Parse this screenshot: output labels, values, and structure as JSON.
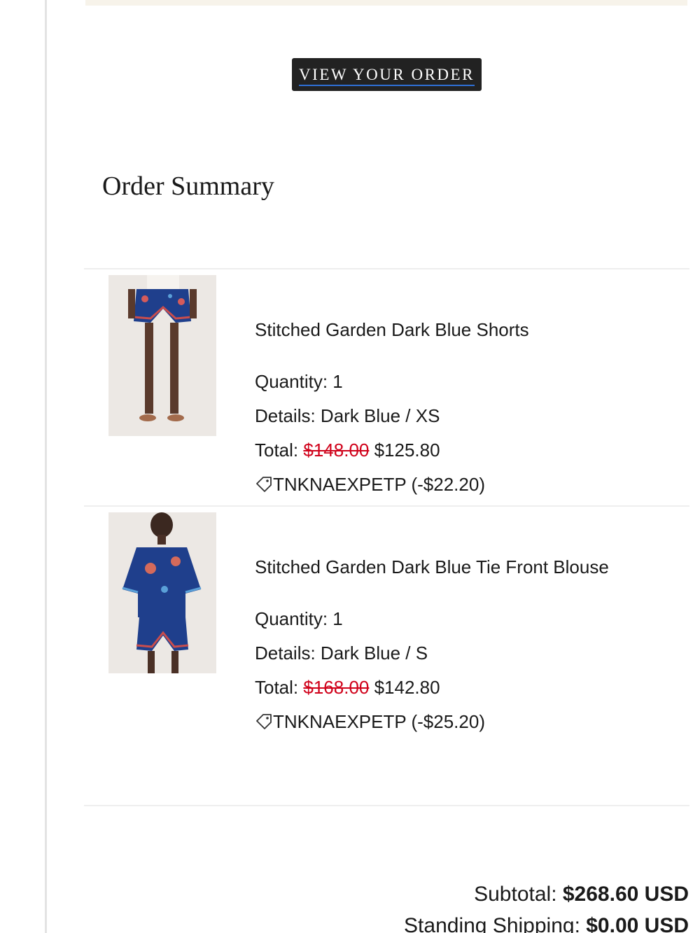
{
  "cta": {
    "view_order_label": "VIEW YOUR ORDER"
  },
  "summary": {
    "title": "Order Summary"
  },
  "items": [
    {
      "name": "Stitched Garden Dark Blue Shorts",
      "quantity_label": "Quantity: 1",
      "details_label": "Details: Dark Blue / XS",
      "total_prefix": "Total: ",
      "original_price": "$148.00",
      "sale_price": " $125.80",
      "discount_code": "TNKNAEXPETP",
      "discount_amount": " (-$22.20)",
      "image_icon": "product-photo-shorts"
    },
    {
      "name": "Stitched Garden Dark Blue Tie Front Blouse",
      "quantity_label": "Quantity: 1",
      "details_label": "Details: Dark Blue / S",
      "total_prefix": "Total: ",
      "original_price": "$168.00",
      "sale_price": " $142.80",
      "discount_code": "TNKNAEXPETP",
      "discount_amount": " (-$25.20)",
      "image_icon": "product-photo-blouse"
    }
  ],
  "totals": {
    "subtotal_label": "Subtotal: ",
    "subtotal_value": "$268.60 USD",
    "shipping_label": "Standing Shipping: ",
    "shipping_value": "$0.00 USD"
  },
  "colors": {
    "strike_price": "#d0021b",
    "button_bg": "#222222",
    "button_underline": "#2f6fd6",
    "top_band": "#f7f3ea"
  }
}
